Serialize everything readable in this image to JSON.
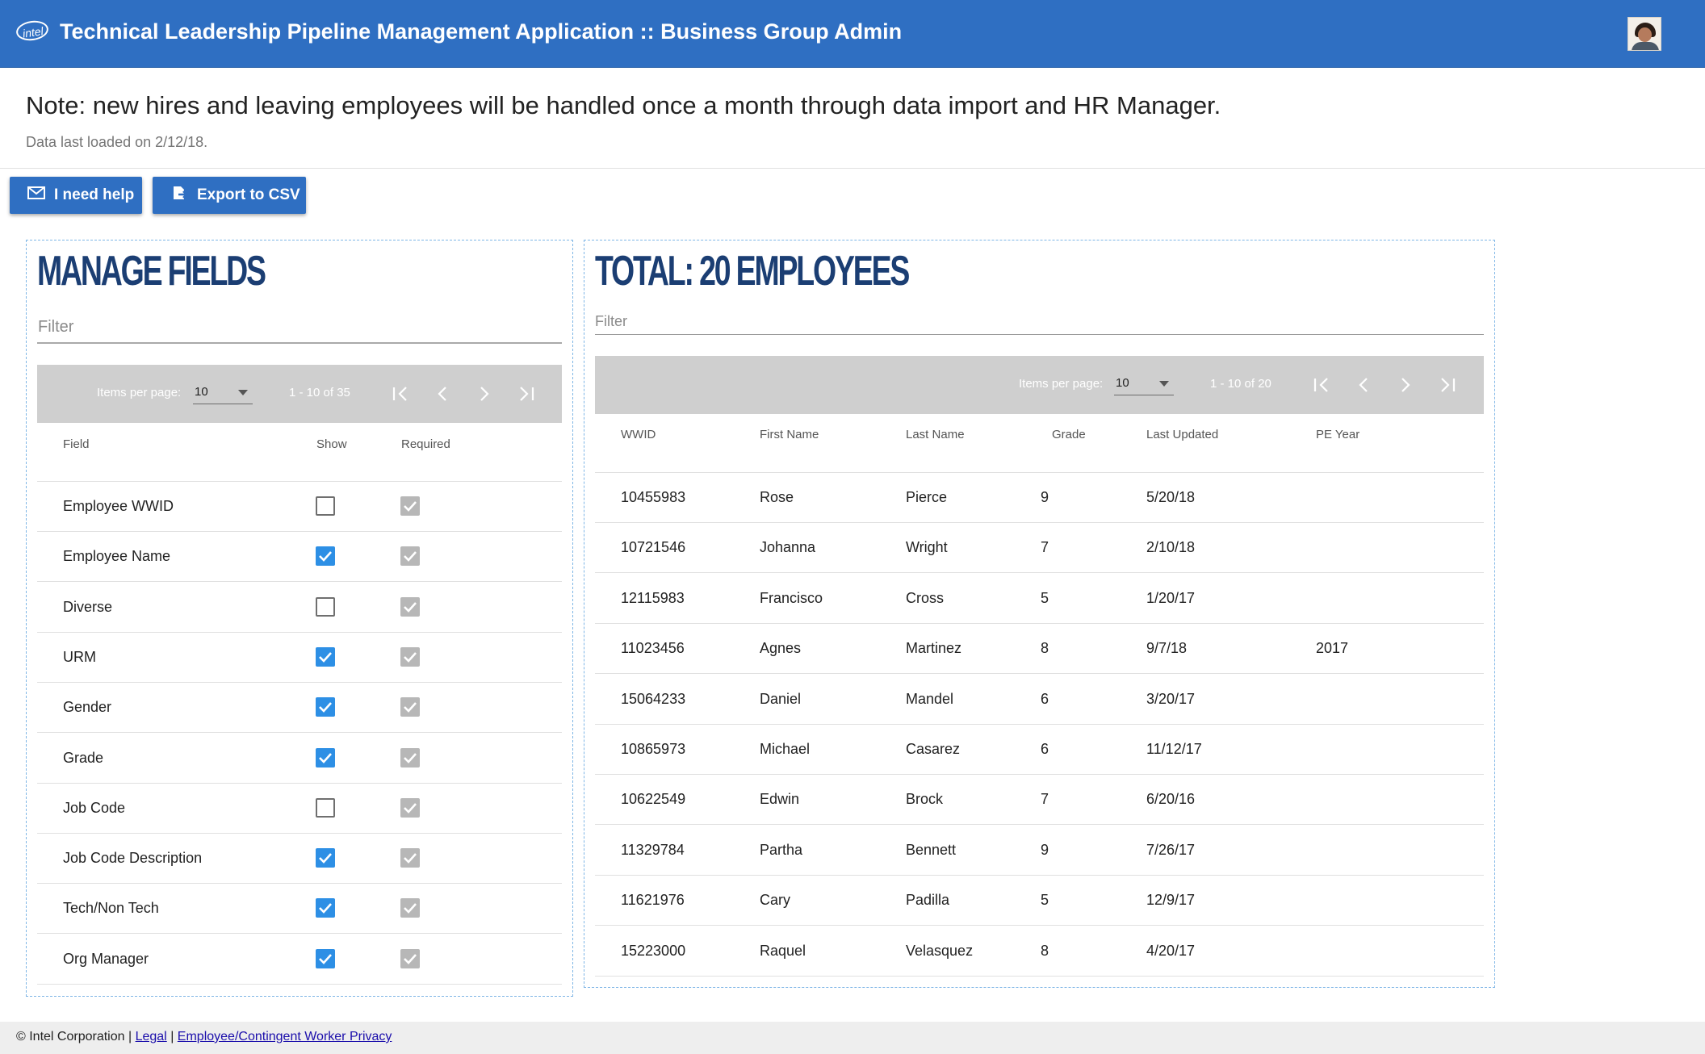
{
  "header": {
    "logo_text": "intel",
    "title": "Technical Leadership Pipeline Management Application :: Business Group Admin",
    "brand_color": "#2f6fc2"
  },
  "notice": {
    "note": "Note: new hires and leaving employees will be handled once a month through data import and HR Manager.",
    "loaded": "Data last loaded on 2/12/18."
  },
  "toolbar": {
    "help_label": "I need help",
    "export_label": "Export to CSV"
  },
  "manage_fields": {
    "title": "MANAGE FIELDS",
    "filter_placeholder": "Filter",
    "paginator": {
      "items_per_page_label": "Items per page:",
      "page_size": "10",
      "range": "1 - 10 of 35"
    },
    "columns": [
      "Field",
      "Show",
      "Required"
    ],
    "rows": [
      {
        "field": "Employee WWID",
        "show": false,
        "required": true
      },
      {
        "field": "Employee Name",
        "show": true,
        "required": true
      },
      {
        "field": "Diverse",
        "show": false,
        "required": true
      },
      {
        "field": "URM",
        "show": true,
        "required": true
      },
      {
        "field": "Gender",
        "show": true,
        "required": true
      },
      {
        "field": "Grade",
        "show": true,
        "required": true
      },
      {
        "field": "Job Code",
        "show": false,
        "required": true
      },
      {
        "field": "Job Code Description",
        "show": true,
        "required": true
      },
      {
        "field": "Tech/Non Tech",
        "show": true,
        "required": true
      },
      {
        "field": "Org Manager",
        "show": true,
        "required": true
      }
    ]
  },
  "employees": {
    "title": "TOTAL: 20 EMPLOYEES",
    "filter_placeholder": "Filter",
    "paginator": {
      "items_per_page_label": "Items per page:",
      "page_size": "10",
      "range": "1 - 10 of 20"
    },
    "columns": [
      "WWID",
      "First Name",
      "Last Name",
      "Grade",
      "Last Updated",
      "PE Year"
    ],
    "rows": [
      [
        "10455983",
        "Rose",
        "Pierce",
        "9",
        "5/20/18",
        ""
      ],
      [
        "10721546",
        "Johanna",
        "Wright",
        "7",
        "2/10/18",
        ""
      ],
      [
        "12115983",
        "Francisco",
        "Cross",
        "5",
        "1/20/17",
        ""
      ],
      [
        "11023456",
        "Agnes",
        "Martinez",
        "8",
        "9/7/18",
        "2017"
      ],
      [
        "15064233",
        "Daniel",
        "Mandel",
        "6",
        "3/20/17",
        ""
      ],
      [
        "10865973",
        "Michael",
        "Casarez",
        "6",
        "11/12/17",
        ""
      ],
      [
        "10622549",
        "Edwin",
        "Brock",
        "7",
        "6/20/16",
        ""
      ],
      [
        "11329784",
        "Partha",
        "Bennett",
        "9",
        "7/26/17",
        ""
      ],
      [
        "11621976",
        "Cary",
        "Padilla",
        "5",
        "12/9/17",
        ""
      ],
      [
        "15223000",
        "Raquel",
        "Velasquez",
        "8",
        "4/20/17",
        ""
      ]
    ]
  },
  "footer": {
    "copyright": "© Intel Corporation |",
    "separator": "|",
    "legal": "Legal",
    "privacy": "Employee/Contingent Worker Privacy"
  }
}
